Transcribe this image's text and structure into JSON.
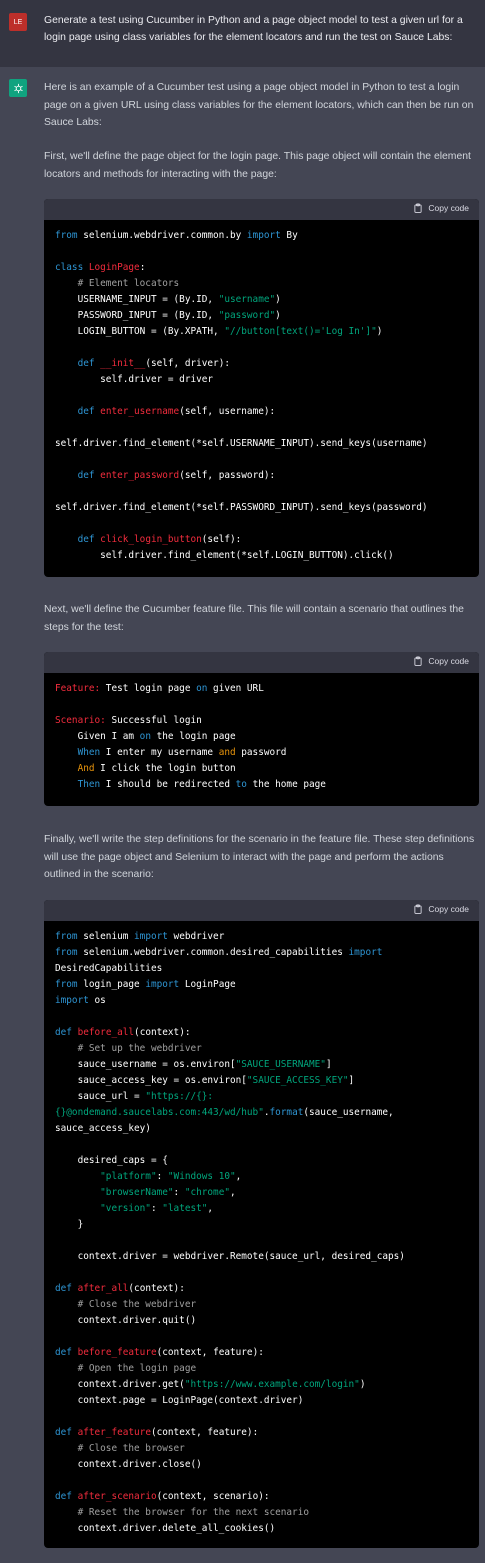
{
  "user": {
    "avatar": "LE",
    "message": "Generate a test using Cucumber in Python and a page object model to test a given url for a login page using class variables for the element locators and run the test on Sauce Labs:"
  },
  "assistant": {
    "avatar_icon": "openai-logo-icon",
    "intro": "Here is an example of a Cucumber test using a page object model in Python to test a login page on a given URL using class variables for the element locators, which can then be run on Sauce Labs:",
    "p1": "First, we'll define the page object for the login page. This page object will contain the element locators and methods for interacting with the page:",
    "p2": "Next, we'll define the Cucumber feature file. This file will contain a scenario that outlines the steps for the test:",
    "p3": "Finally, we'll write the step definitions for the scenario in the feature file. These step definitions will use the page object and Selenium to interact with the page and perform the actions outlined in the scenario:",
    "copy_label": "Copy code"
  },
  "colors": {
    "user_bg": "#343541",
    "assistant_bg": "#444654",
    "code_bg": "#000000",
    "code_header": "#343541",
    "keyword": "#2e95d3",
    "name": "#f22c3d",
    "string": "#00a67d",
    "comment": "#a0a0a0"
  }
}
